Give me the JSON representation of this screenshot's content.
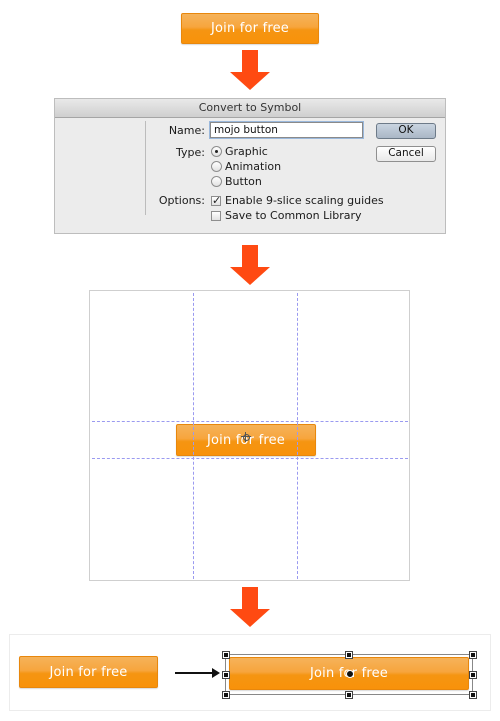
{
  "top_button": {
    "label": "Join for free"
  },
  "dialog": {
    "title": "Convert to Symbol",
    "name_label": "Name:",
    "name_value": "mojo button",
    "type_label": "Type:",
    "type_options": [
      {
        "label": "Graphic",
        "selected": true
      },
      {
        "label": "Animation",
        "selected": false
      },
      {
        "label": "Button",
        "selected": false
      }
    ],
    "options_label": "Options:",
    "checkboxes": [
      {
        "label": "Enable 9-slice scaling guides",
        "checked": true,
        "mark": "✓"
      },
      {
        "label": "Save to Common Library",
        "checked": false,
        "mark": ""
      }
    ],
    "ok_label": "OK",
    "cancel_label": "Cancel"
  },
  "stage": {
    "button_label": "Join for free",
    "registration_icon": "crosshair-icon"
  },
  "result": {
    "before_label": "Join for free",
    "after_label": "Join for free",
    "arrow_icon": "right-arrow-icon"
  },
  "colors": {
    "accent_orange": "#f7a53d",
    "arrow_red": "#ff4a12",
    "guide_blue": "#9a9af0"
  }
}
